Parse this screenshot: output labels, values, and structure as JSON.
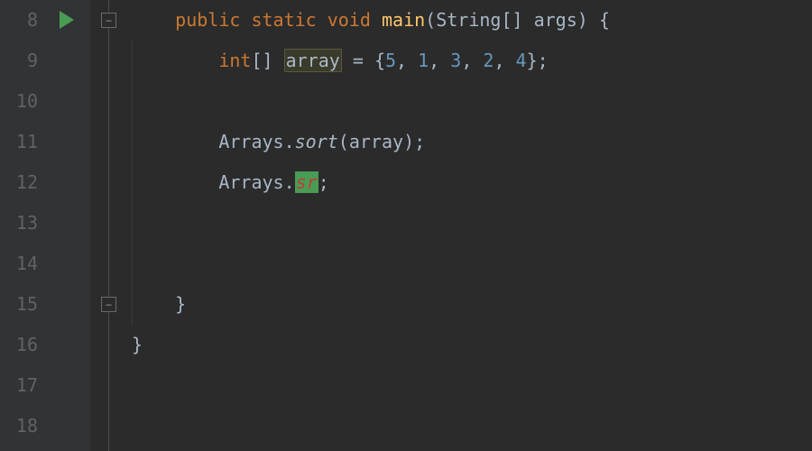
{
  "lineNumbers": [
    "8",
    "9",
    "10",
    "11",
    "12",
    "13",
    "14",
    "15",
    "16",
    "17",
    "18"
  ],
  "line8": {
    "kw_public": "public",
    "kw_static": "static",
    "kw_void": "void",
    "method": "main",
    "paramType": "String",
    "brackets": "[]",
    "paramName": "args",
    "open": "(",
    "close": ")",
    "brace": "{"
  },
  "line9": {
    "type": "int",
    "brackets": "[]",
    "varname": "array",
    "eq": " = ",
    "lb": "{",
    "n1": "5",
    "n2": "1",
    "n3": "3",
    "n4": "2",
    "n5": "4",
    "comma": ", ",
    "rb": "}",
    "semi": ";"
  },
  "line11": {
    "cls": "Arrays",
    "dot": ".",
    "method": "sort",
    "open": "(",
    "arg": "array",
    "close": ")",
    "semi": ";"
  },
  "line12": {
    "cls": "Arrays",
    "dot": ".",
    "err": "sr",
    "semi": ";"
  },
  "line15": {
    "brace": "}"
  },
  "line16": {
    "brace": "}"
  }
}
